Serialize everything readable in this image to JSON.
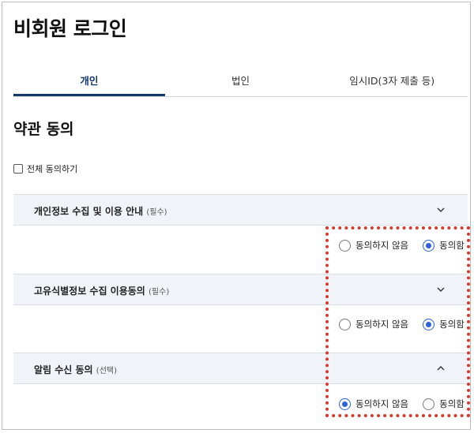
{
  "page": {
    "title": "비회원 로그인"
  },
  "tabs": [
    {
      "label": "개인",
      "active": true
    },
    {
      "label": "법인",
      "active": false
    },
    {
      "label": "임시ID(3자 제출 등)",
      "active": false
    }
  ],
  "terms": {
    "title": "약관 동의",
    "agree_all_label": "전체 동의하기",
    "agree_all_checked": false,
    "sections": [
      {
        "label": "개인정보 수집 및 이용 안내",
        "tag": "(필수)",
        "expanded": false,
        "chevron": "chevron-down-icon",
        "disagree_label": "동의하지 않음",
        "agree_label": "동의함",
        "selected": "agree"
      },
      {
        "label": "고유식별정보 수집 이용동의",
        "tag": "(필수)",
        "expanded": false,
        "chevron": "chevron-down-icon",
        "disagree_label": "동의하지 않음",
        "agree_label": "동의함",
        "selected": "agree"
      },
      {
        "label": "알림 수신 동의",
        "tag": "(선택)",
        "expanded": true,
        "chevron": "chevron-up-icon",
        "disagree_label": "동의하지 않음",
        "agree_label": "동의함",
        "selected": "disagree"
      }
    ]
  },
  "colors": {
    "accent": "#12386e",
    "radio_selected": "#2e62d6",
    "highlight_box": "#d63a2b",
    "section_bg": "#f0f3f7"
  }
}
